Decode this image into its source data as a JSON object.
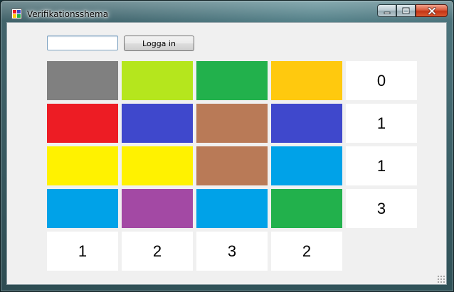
{
  "window": {
    "title": "Verifikationsshema",
    "controls": {
      "minimize": "minimize",
      "maximize": "maximize",
      "close": "close"
    }
  },
  "login": {
    "input_value": "",
    "button_label": "Logga in"
  },
  "grid": {
    "colors": [
      [
        "#808080",
        "#b5e61d",
        "#22b14c",
        "#ffc90e"
      ],
      [
        "#ed1c24",
        "#3f48cc",
        "#b97a57",
        "#3f48cc"
      ],
      [
        "#fff200",
        "#fff200",
        "#b97a57",
        "#00a2e8"
      ],
      [
        "#00a2e8",
        "#a349a4",
        "#00a2e8",
        "#22b14c"
      ]
    ],
    "row_numbers": [
      "0",
      "1",
      "1",
      "3"
    ],
    "column_numbers": [
      "1",
      "2",
      "3",
      "2"
    ]
  }
}
